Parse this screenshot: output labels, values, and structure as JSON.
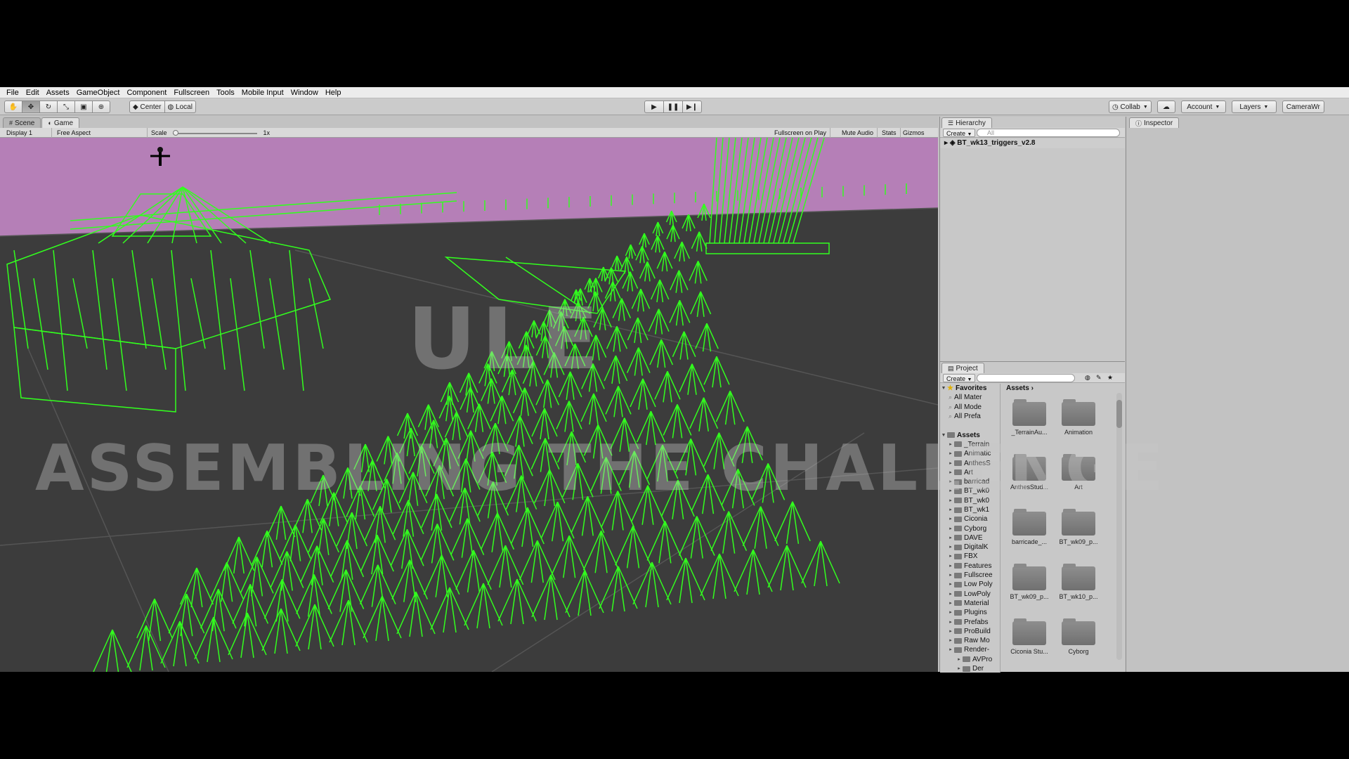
{
  "menubar": [
    "File",
    "Edit",
    "Assets",
    "GameObject",
    "Component",
    "Fullscreen",
    "Tools",
    "Mobile Input",
    "Window",
    "Help"
  ],
  "toolbar": {
    "pivot_center": "Center",
    "pivot_local": "Local",
    "collab": "Collab",
    "account": "Account",
    "layers": "Layers",
    "layout": "CameraWr"
  },
  "game": {
    "tabs": [
      "Scene",
      "Game"
    ],
    "display": "Display 1",
    "aspect": "Free Aspect",
    "scale_label": "Scale",
    "scale_value": "1x",
    "maximize": "Fullscreen on Play",
    "mute": "Mute Audio",
    "stats": "Stats",
    "gizmos": "Gizmos",
    "sky_color": "#b57fb7",
    "wire_color": "#32ff1e"
  },
  "hierarchy": {
    "tab": "Hierarchy",
    "create": "Create",
    "search_placeholder": "All",
    "scene": "BT_wk13_triggers_v2.8"
  },
  "project": {
    "tab": "Project",
    "create": "Create",
    "favorites_label": "Favorites",
    "favorites": [
      "All Mater",
      "All Mode",
      "All Prefa"
    ],
    "assets_label": "Assets",
    "tree": [
      "_Terrain",
      "Animatic",
      "AnthesS",
      "Art",
      "barricad",
      "BT_wk0",
      "BT_wk0",
      "BT_wk1",
      "Ciconia",
      "Cyborg",
      "DAVE",
      "DigitalK",
      "FBX",
      "Features",
      "Fullscree",
      "Low Poly",
      "LowPoly",
      "Material",
      "Plugins",
      "Prefabs",
      "ProBuild",
      "Raw Mo",
      "Render-",
      "AVPro",
      "Der"
    ],
    "breadcrumb": "Assets",
    "grid": [
      "_TerrainAu...",
      "Animation",
      "AnthesStud...",
      "Art",
      "barricade_...",
      "BT_wk09_p...",
      "BT_wk09_p...",
      "BT_wk10_p...",
      "Ciconia Stu...",
      "Cyborg"
    ]
  },
  "inspector": {
    "tab": "Inspector"
  },
  "watermark": {
    "line1": "ULE",
    "line2": "ASSEMBLING THE CHALLENGE"
  }
}
